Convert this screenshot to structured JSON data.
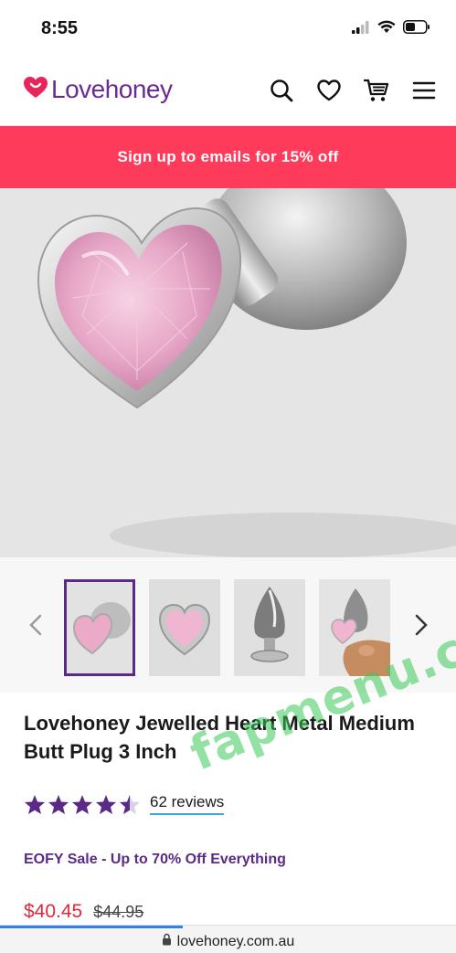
{
  "status_bar": {
    "time": "8:55"
  },
  "header": {
    "logo_text": "Lovehoney",
    "icons": [
      "search-icon",
      "heart-icon",
      "cart-icon",
      "menu-icon"
    ]
  },
  "promo": {
    "text": "Sign up to emails for 15% off"
  },
  "gallery": {
    "thumbnails": [
      "thumbnail-1",
      "thumbnail-2",
      "thumbnail-3",
      "thumbnail-4"
    ],
    "active_index": 0
  },
  "product": {
    "title": "Lovehoney Jewelled Heart Metal Medium Butt Plug 3 Inch",
    "rating_value": 4.5,
    "rating_max": 5,
    "reviews_label": "62 reviews",
    "sale_text": "EOFY Sale - Up to 70% Off Everything",
    "price_current": "$40.45",
    "price_old": "$44.95"
  },
  "browser": {
    "url": "lovehoney.com.au"
  },
  "watermark": {
    "text": "fapmenu.com"
  },
  "colors": {
    "brand_purple": "#6a2c91",
    "promo_pink": "#ff3b5c",
    "star_purple": "#5b2a86",
    "price_red": "#e0283b",
    "link_underline": "#3aa6d9"
  }
}
